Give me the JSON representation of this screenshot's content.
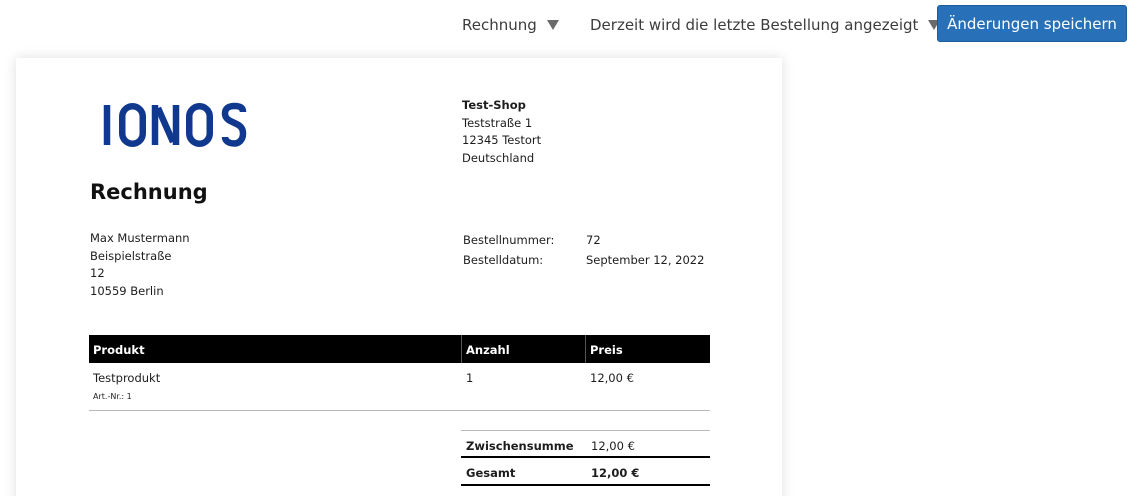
{
  "toolbar": {
    "document_type": "Rechnung",
    "order_selector": "Derzeit wird die letzte Bestellung angezeigt",
    "save_label": "Änderungen speichern",
    "save_color": "#2871b8"
  },
  "invoice": {
    "logo_text": "IONOS",
    "logo_color": "#11388f",
    "shop": {
      "name": "Test-Shop",
      "street": "Teststraße 1",
      "city": "12345 Testort",
      "country": "Deutschland"
    },
    "title": "Rechnung",
    "customer": {
      "name": "Max Mustermann",
      "street": "Beispielstraße",
      "house_number": "12",
      "city": "10559 Berlin"
    },
    "order_number_label": "Bestellnummer:",
    "order_number": "72",
    "order_date_label": "Bestelldatum:",
    "order_date": "September 12, 2022",
    "table": {
      "headers": [
        "Produkt",
        "Anzahl",
        "Preis"
      ],
      "items": [
        {
          "product": "Testprodukt",
          "sku": "Art.-Nr.: 1",
          "quantity": "1",
          "price": "12,00 €"
        }
      ]
    },
    "totals": {
      "subtotal_label": "Zwischensumme",
      "subtotal": "12,00 €",
      "total_label": "Gesamt",
      "total": "12,00 €"
    }
  }
}
